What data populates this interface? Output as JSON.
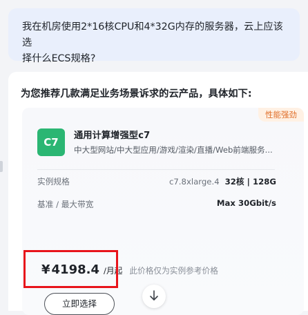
{
  "user_message": {
    "line1": "我在机房使用2*16核CPU和4*32G内存的服务器，云上应该选",
    "line2": "择什么ECS规格?"
  },
  "answer": {
    "title": "为您推荐几款满足业务场景诉求的云产品，具体如下:"
  },
  "product": {
    "badge": "性能强劲",
    "logo_text": "C7",
    "logo_color": "#2bb673",
    "name": "通用计算增强型c7",
    "description": "中大型网站/中大型应用/游戏/渲染/直播/Web前端服务...",
    "specs": {
      "instance_label": "实例规格",
      "instance_type": "c7.8xlarge.4",
      "instance_cores_memory": "32核 | 128G",
      "bandwidth_label": "基准 / 最大带宽",
      "bandwidth_value": "Max 30Gbit/s"
    },
    "price": {
      "symbol": "¥",
      "amount": "4198.4",
      "unit": "/月起",
      "note": "此价格仅为实例参考价格"
    },
    "select_button_label": "立即选择"
  },
  "icons": {
    "scroll_down": "arrow-down-icon"
  },
  "colors": {
    "badge_text": "#e0702c",
    "badge_bg": "#fff1e4",
    "highlight_border": "#e8141b",
    "user_bubble_bg": "#e9effc"
  }
}
